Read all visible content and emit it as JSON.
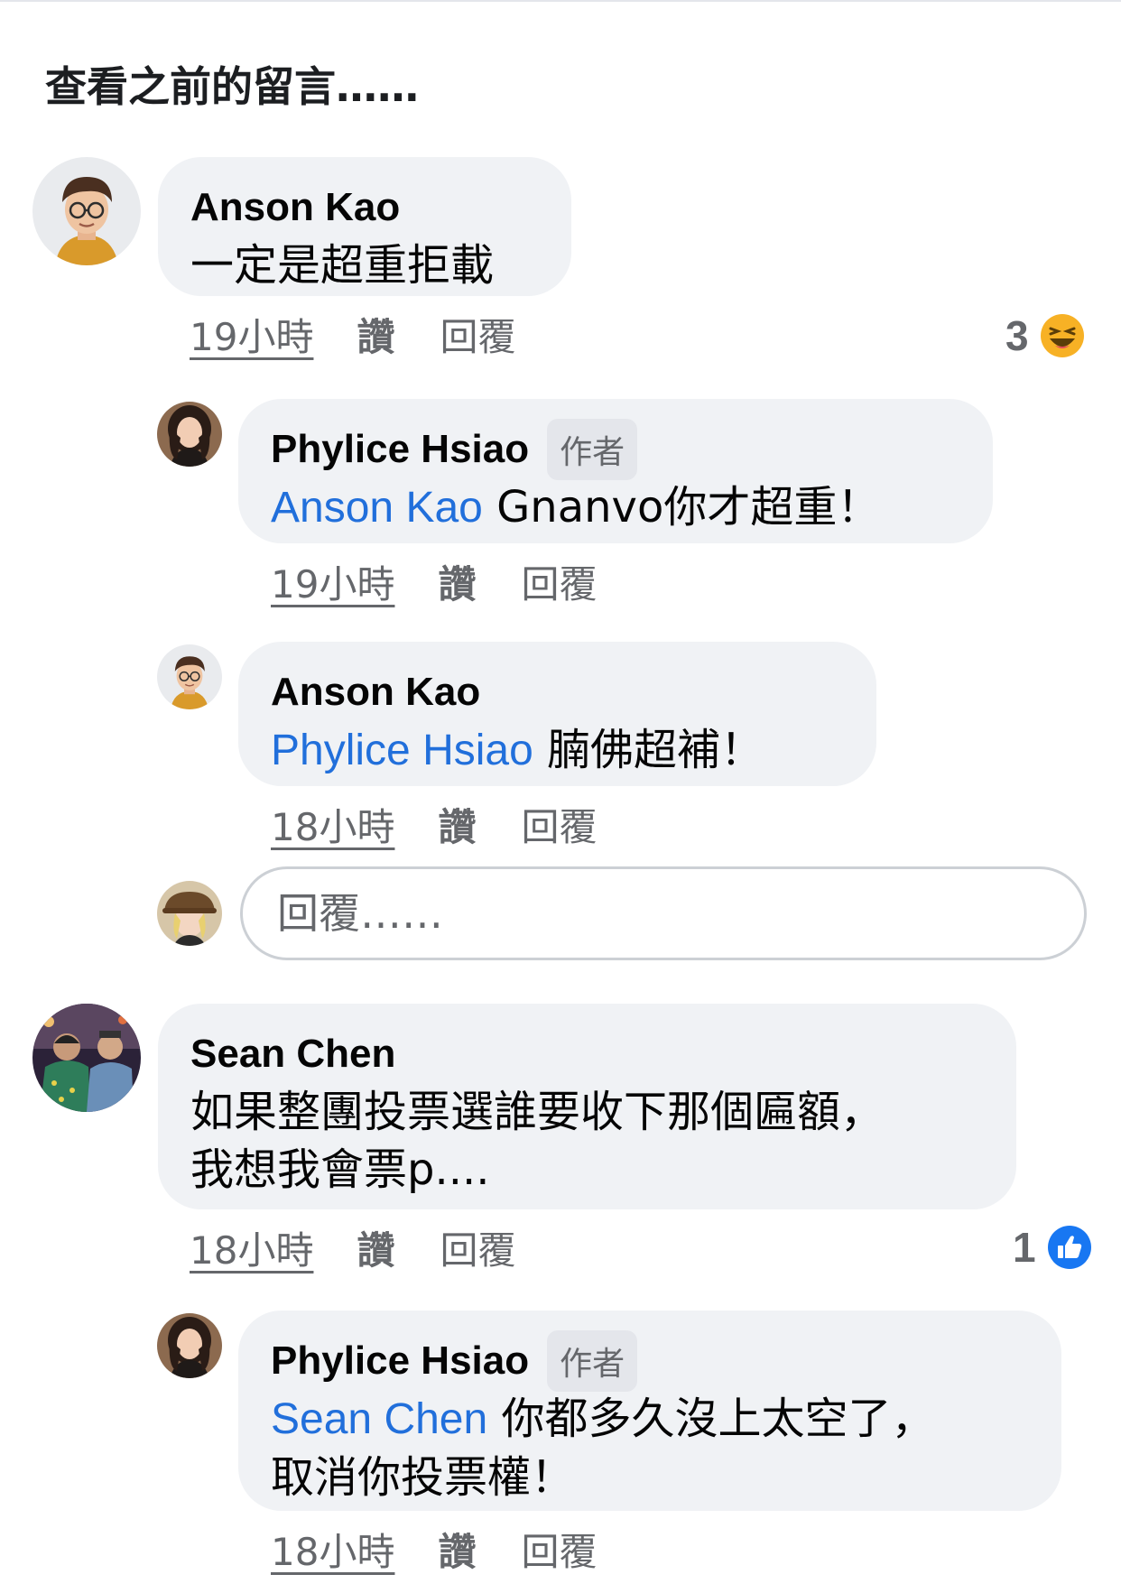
{
  "view_previous": "查看之前的留言……",
  "comments": [
    {
      "author": "Anson Kao",
      "text": "一定是超重拒載",
      "time": "19小時",
      "like": "讚",
      "reply": "回覆",
      "reaction_count": "3",
      "reaction_icon": "laughing-face-icon",
      "avatar_icon": "memoji-avatar-icon"
    },
    {
      "author": "Phylice Hsiao",
      "badge": "作者",
      "mention": "Anson Kao",
      "text": " Gnanvo你才超重！",
      "time": "19小時",
      "like": "讚",
      "reply": "回覆",
      "avatar_icon": "portrait-avatar-icon"
    },
    {
      "author": "Anson Kao",
      "mention": "Phylice Hsiao",
      "text": " 腩佛超補！",
      "time": "18小時",
      "like": "讚",
      "reply": "回覆",
      "avatar_icon": "memoji-avatar-icon"
    },
    {
      "author": "Sean Chen",
      "text_line1": "如果整團投票選誰要收下那個匾額，",
      "text_line2": "我想我會票p....",
      "time": "18小時",
      "like": "讚",
      "reply": "回覆",
      "reaction_count": "1",
      "reaction_icon": "thumbs-up-icon",
      "avatar_icon": "group-photo-avatar-icon"
    },
    {
      "author": "Phylice Hsiao",
      "badge": "作者",
      "mention": "Sean Chen",
      "text_line1": " 你都多久沒上太空了，",
      "text_line2": "取消你投票權！",
      "time": "18小時",
      "like": "讚",
      "reply": "回覆",
      "avatar_icon": "portrait-avatar-icon"
    }
  ],
  "reply_box": {
    "placeholder": "回覆……",
    "avatar_icon": "hat-avatar-icon"
  },
  "colors": {
    "mention": "#216fdb",
    "bubble": "#f0f2f5",
    "meta": "#65676b",
    "like_blue": "#1877f2",
    "haha_yellow": "#f7b125"
  }
}
